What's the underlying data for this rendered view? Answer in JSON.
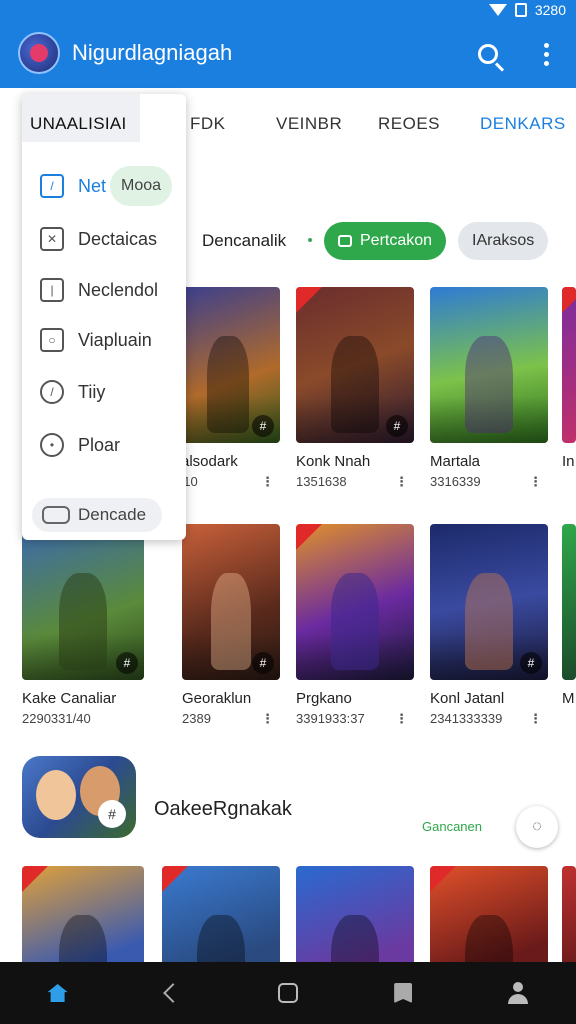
{
  "status_bar": {
    "time": "3280"
  },
  "app_bar": {
    "title": "Nigurdlagniagah",
    "search_icon": "search-icon",
    "menu_icon": "more-vert-icon",
    "color": "#1b7fe0"
  },
  "tabs": [
    {
      "label": "FDK"
    },
    {
      "label": "VEINBR"
    },
    {
      "label": "REOES"
    },
    {
      "label": "DENKARS",
      "active": true
    }
  ],
  "drawer": {
    "header": "UNAALISIAI",
    "items": [
      {
        "label": "Net",
        "icon": "edit-icon",
        "active": true
      },
      {
        "label": "Dectaicas",
        "icon": "tools-icon"
      },
      {
        "label": "Neclendol",
        "icon": "square-icon"
      },
      {
        "label": "Viapluain",
        "icon": "camera-icon"
      },
      {
        "label": "Tiiy",
        "icon": "slash-icon"
      },
      {
        "label": "Ploar",
        "icon": "face-icon"
      }
    ],
    "tag": "Mooa",
    "footer": "Dencade"
  },
  "filter": {
    "section_label": "Dencanalik",
    "chip_primary": "Pertcakon",
    "chip_secondary": "IAraksos"
  },
  "row1": [
    {
      "title": "ralsodark",
      "meta": "310"
    },
    {
      "title": "Konk Nnah",
      "meta": "1351638"
    },
    {
      "title": "Martala",
      "meta": "3316339"
    },
    {
      "title": "In",
      "meta": ""
    }
  ],
  "row2": [
    {
      "title": "Kake Canaliar",
      "meta": "2290331/40"
    },
    {
      "title": "Georaklun",
      "meta": "2389"
    },
    {
      "title": "Prgkano",
      "meta": "3391933:37"
    },
    {
      "title": "Konl Jatanl",
      "meta": "2341333339"
    },
    {
      "title": "M",
      "meta": ""
    }
  ],
  "featured": {
    "title": "OakeeRgnakak",
    "link": "Gancanen"
  },
  "bottom_nav": [
    "home-icon",
    "back-icon",
    "overview-icon",
    "bookmark-icon",
    "profile-icon"
  ]
}
